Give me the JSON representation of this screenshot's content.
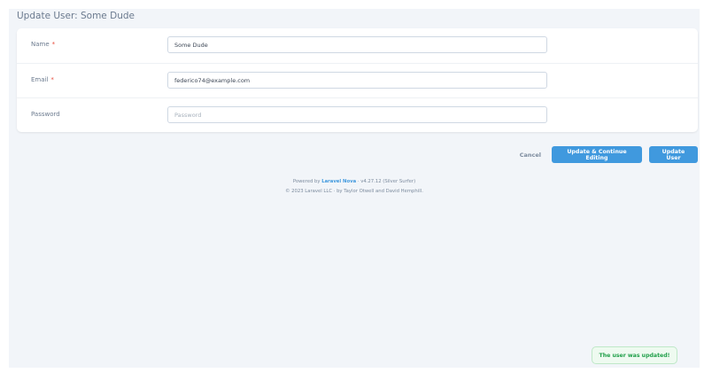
{
  "header": {
    "title": "Update User: Some Dude"
  },
  "form": {
    "fields": [
      {
        "label": "Name",
        "required_mark": "*",
        "value": "Some Dude",
        "placeholder": ""
      },
      {
        "label": "Email",
        "required_mark": "*",
        "value": "federico74@example.com",
        "placeholder": ""
      },
      {
        "label": "Password",
        "required_mark": "",
        "value": "",
        "placeholder": "Password"
      }
    ]
  },
  "actions": {
    "cancel_label": "Cancel",
    "continue_label": "Update & Continue Editing",
    "update_label": "Update User"
  },
  "footer": {
    "powered_prefix": "Powered by ",
    "brand": "Laravel Nova",
    "version": " · v4.27.12 (Silver Surfer)",
    "copyright": "© 2023 Laravel LLC · by Taylor Otwell and David Hemphill."
  },
  "toast": {
    "message": "The user was updated!"
  },
  "colors": {
    "primary": "#4099de",
    "background": "#f2f5f9",
    "success": "#21a04a",
    "required": "#e74c3c"
  }
}
